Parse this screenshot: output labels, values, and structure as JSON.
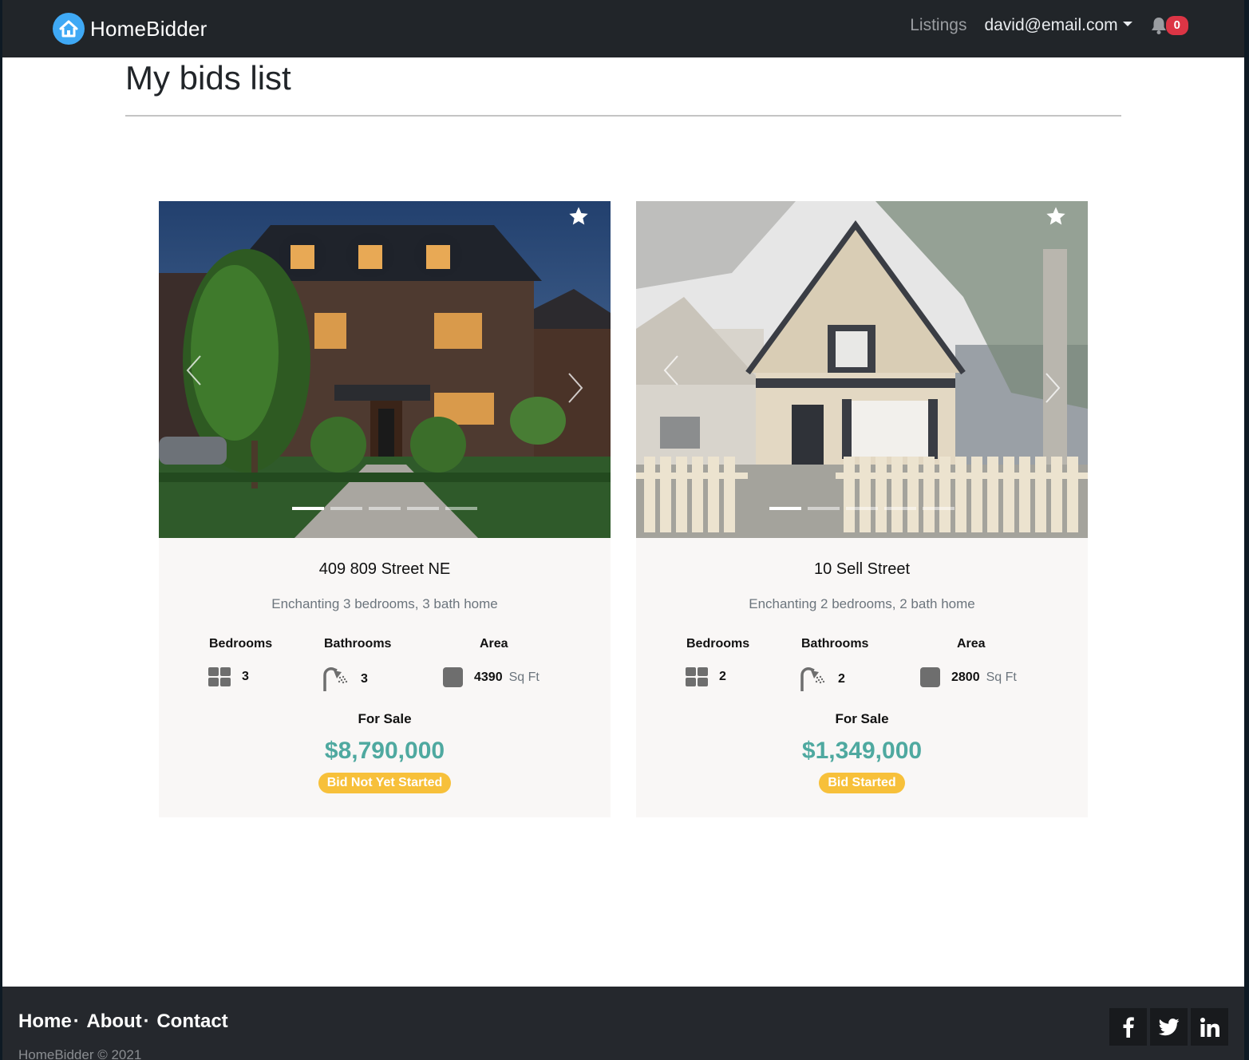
{
  "nav": {
    "brand": "HomeBidder",
    "links": [
      "Listings"
    ],
    "user": "david@email.com",
    "notifications": "0"
  },
  "page": {
    "title": "My bids list"
  },
  "listings": [
    {
      "address": "409 809 Street NE",
      "description": "Enchanting 3 bedrooms, 3 bath home",
      "bedrooms_label": "Bedrooms",
      "bathrooms_label": "Bathrooms",
      "area_label": "Area",
      "bedrooms": "3",
      "bathrooms": "3",
      "area": "4390",
      "area_unit": "Sq Ft",
      "sale_label": "For Sale",
      "price": "$8,790,000",
      "status": "Bid Not Yet Started"
    },
    {
      "address": "10 Sell Street",
      "description": "Enchanting 2 bedrooms, 2 bath home",
      "bedrooms_label": "Bedrooms",
      "bathrooms_label": "Bathrooms",
      "area_label": "Area",
      "bedrooms": "2",
      "bathrooms": "2",
      "area": "2800",
      "area_unit": "Sq Ft",
      "sale_label": "For Sale",
      "price": "$1,349,000",
      "status": "Bid Started"
    }
  ],
  "footer": {
    "links": [
      "Home",
      "About",
      "Contact"
    ],
    "copyright": "HomeBidder © 2021",
    "social": [
      "facebook-icon",
      "twitter-icon",
      "linkedin-icon"
    ]
  },
  "colors": {
    "navbar": "#212529",
    "price": "#4fa9a0",
    "status_badge": "#f7c03a",
    "notification_badge": "#dc3545",
    "brand_logo": "#3fa9f5"
  }
}
